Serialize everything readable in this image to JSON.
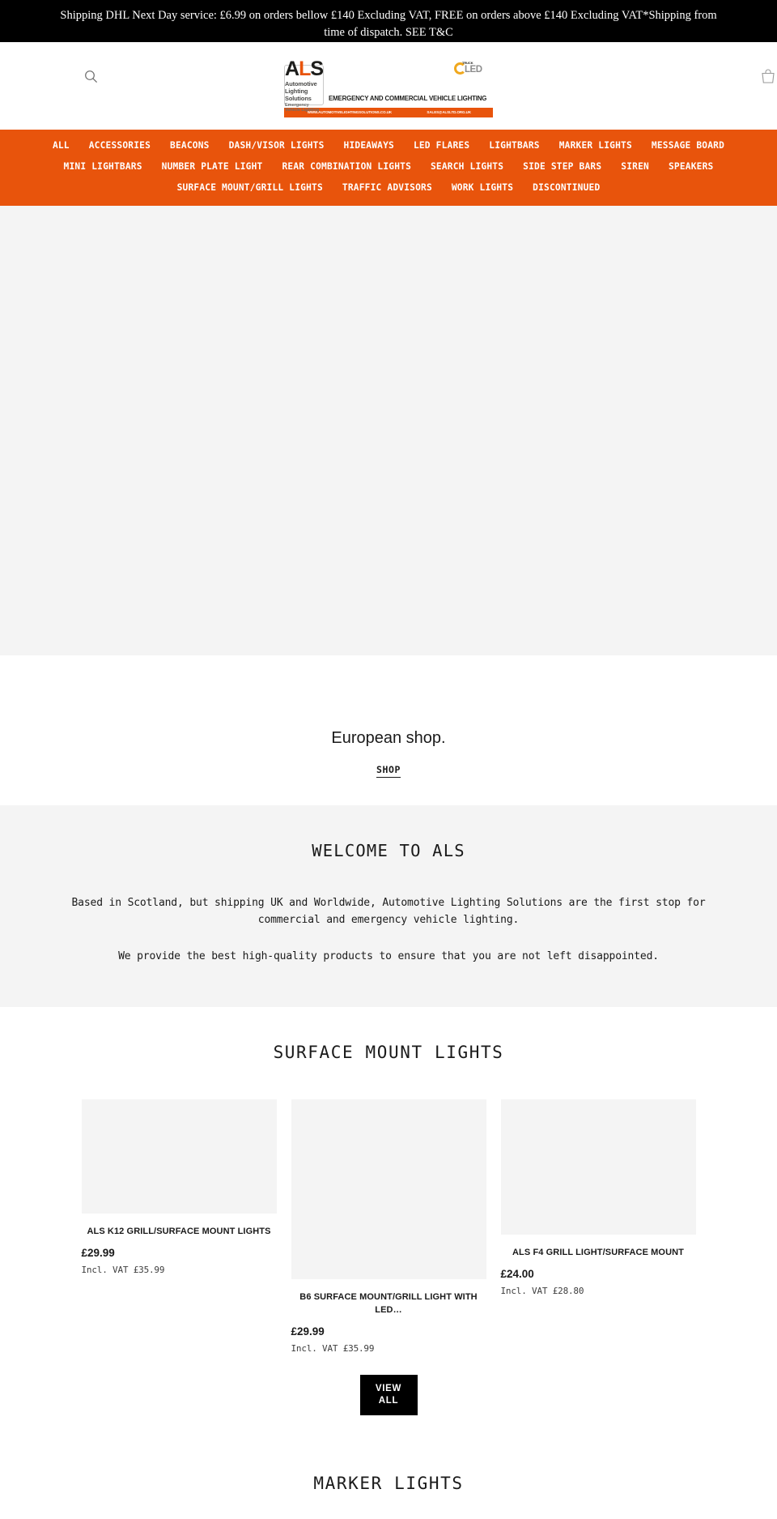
{
  "announcement": {
    "text": "Shipping DHL Next Day service: £6.99 on orders bellow £140 Excluding VAT, FREE on orders above £140 Excluding VAT*Shipping from time of dispatch. SEE T&C"
  },
  "header": {
    "search_icon": "search-icon",
    "cart_icon": "cart-icon",
    "logo": {
      "brand": "ALS",
      "brand_a": "A",
      "brand_l": "L",
      "brand_s": "S",
      "sub_line1": "Automotive Lighting Solutions",
      "sub_line2": "Emergency Vehicle Lighting",
      "tagline": "EMERGENCY AND COMMERCIAL VEHICLE LIGHTING",
      "badge_top": "TRUCK",
      "badge_main": "LED",
      "bar_website": "WWW.AUTOMOTIVELIGHTINGSOLUTIONS.CO.UK",
      "bar_email": "SALES@ALSLTD.ORG.UK",
      "accent_color": "#e8540c"
    }
  },
  "nav": {
    "background_color": "#e8540c",
    "rows": [
      [
        "ALL",
        "ACCESSORIES",
        "BEACONS",
        "DASH/VISOR LIGHTS",
        "HIDEAWAYS",
        "LED FLARES",
        "LIGHTBARS",
        "MARKER LIGHTS",
        "MESSAGE BOARD"
      ],
      [
        "MINI LIGHTBARS",
        "NUMBER PLATE LIGHT",
        "REAR COMBINATION LIGHTS",
        "SEARCH LIGHTS",
        "SIDE STEP BARS",
        "SIREN",
        "SPEAKERS"
      ],
      [
        "SURFACE MOUNT/GRILL LIGHTS",
        "TRAFFIC ADVISORS",
        "WORK LIGHTS",
        "DISCONTINUED"
      ]
    ]
  },
  "euro_block": {
    "title": "European shop.",
    "link_label": "SHOP"
  },
  "welcome": {
    "heading": "WELCOME TO ALS",
    "paragraph1": "Based in Scotland, but shipping UK and Worldwide, Automotive Lighting Solutions are the first stop for commercial and emergency vehicle lighting.",
    "paragraph2": "We provide the best high-quality products to ensure that you are not left disappointed."
  },
  "surface_mount_section": {
    "heading": "SURFACE MOUNT LIGHTS",
    "view_all_line1": "VIEW",
    "view_all_line2": "ALL",
    "products": [
      {
        "title": "ALS K12 GRILL/SURFACE MOUNT LIGHTS",
        "price": "£29.99",
        "vat": "Incl. VAT £35.99"
      },
      {
        "title": "B6 SURFACE MOUNT/GRILL LIGHT WITH LED…",
        "price": "£29.99",
        "vat": "Incl. VAT £35.99"
      },
      {
        "title": "ALS F4 GRILL LIGHT/SURFACE MOUNT",
        "price": "£24.00",
        "vat": "Incl. VAT £28.80"
      }
    ]
  },
  "marker_section": {
    "heading": "MARKER LIGHTS"
  }
}
